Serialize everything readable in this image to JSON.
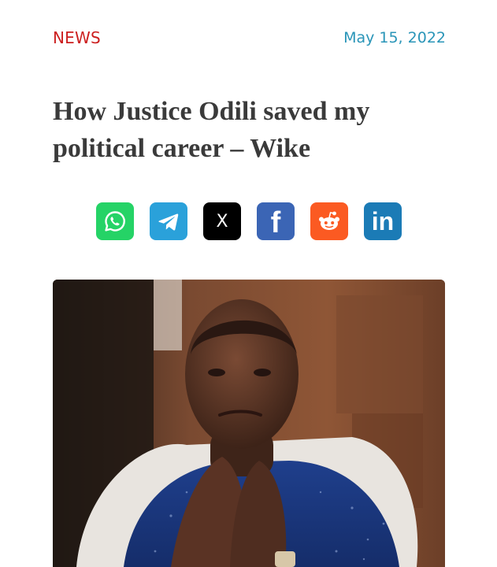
{
  "article": {
    "category": "NEWS",
    "date": "May 15, 2022",
    "title_line1": "How Justice Odili saved my",
    "title_line2": "political career – Wike"
  },
  "share": {
    "buttons": [
      {
        "network": "whatsapp",
        "icon": "whatsapp-icon",
        "color": "#25d366"
      },
      {
        "network": "telegram",
        "icon": "telegram-icon",
        "color": "#2aa1da"
      },
      {
        "network": "x",
        "icon": "x-icon",
        "color": "#000000"
      },
      {
        "network": "facebook",
        "icon": "facebook-icon",
        "color": "#3b65b5"
      },
      {
        "network": "reddit",
        "icon": "reddit-icon",
        "color": "#fb5a22"
      },
      {
        "network": "linkedin",
        "icon": "linkedin-icon",
        "color": "#1b7bb6"
      }
    ],
    "labels": {
      "x": "X",
      "facebook": "f",
      "linkedin": "in"
    }
  },
  "colors": {
    "category": "#cc1f1f",
    "date": "#2a95b8",
    "headline": "#3a3a3a"
  }
}
